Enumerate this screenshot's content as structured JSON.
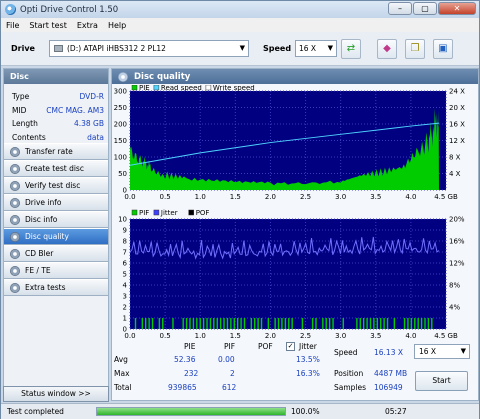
{
  "window": {
    "title": "Opti Drive Control 1.50",
    "btn_min": "–",
    "btn_max": "▢",
    "btn_close": "✕"
  },
  "menu": [
    "File",
    "Start test",
    "Extra",
    "Help"
  ],
  "toolbar": {
    "drive_label": "Drive",
    "drive_value": "(D:)    ATAPI iHBS312   2 PL12",
    "speed_label": "Speed",
    "speed_value": "16 X"
  },
  "sidebar": {
    "header": "Disc",
    "info": [
      {
        "k": "Type",
        "v": "DVD-R"
      },
      {
        "k": "MID",
        "v": "CMC MAG. AM3"
      },
      {
        "k": "Length",
        "v": "4.38 GB"
      },
      {
        "k": "Contents",
        "v": "data"
      }
    ],
    "nav": [
      "Transfer rate",
      "Create test disc",
      "Verify test disc",
      "Drive info",
      "Disc info",
      "Disc quality",
      "CD Bler",
      "FE / TE",
      "Extra tests"
    ],
    "active_index": 5,
    "status_button": "Status window >>"
  },
  "main": {
    "header": "Disc quality"
  },
  "chart_data": [
    {
      "type": "area",
      "legend": [
        "PIE",
        "Read speed",
        "Write speed"
      ],
      "legend_colors": {
        "PIE": "#00cc00",
        "Read speed": "#4fd4ff",
        "Write speed": "#ffffff"
      },
      "x_ticks": [
        "0.0",
        "0.5",
        "1.0",
        "1.5",
        "2.0",
        "2.5",
        "3.0",
        "3.5",
        "4.0",
        "4.5 GB"
      ],
      "y_left_ticks": [
        "0",
        "50",
        "100",
        "150",
        "200",
        "250",
        "300"
      ],
      "y_right_ticks": [
        "4 X",
        "8 X",
        "12 X",
        "16 X",
        "20 X",
        "24 X"
      ],
      "ylim": [
        0,
        300
      ],
      "pie_profile": {
        "x": [
          0,
          0.1,
          0.2,
          0.3,
          0.5,
          0.8,
          1.2,
          1.6,
          2.0,
          2.5,
          3.0,
          3.3,
          3.6,
          3.9,
          4.1,
          4.25,
          4.35,
          4.4
        ],
        "y": [
          120,
          95,
          85,
          70,
          45,
          38,
          30,
          22,
          20,
          20,
          25,
          45,
          55,
          70,
          110,
          150,
          200,
          230
        ]
      },
      "read_speed": {
        "x": [
          0.0,
          1.0,
          2.0,
          3.0,
          4.0,
          4.4
        ],
        "y_x": [
          6.0,
          9.0,
          11.5,
          13.5,
          15.5,
          16.2
        ]
      }
    },
    {
      "type": "bar",
      "legend": [
        "PIF",
        "Jitter",
        "POF"
      ],
      "legend_colors": {
        "PIF": "#00cc00",
        "Jitter": "#4040ff",
        "POF": "#000000"
      },
      "x_ticks": [
        "0.0",
        "0.5",
        "1.0",
        "1.5",
        "2.0",
        "2.5",
        "3.0",
        "3.5",
        "4.0",
        "4.5 GB"
      ],
      "y_left_ticks": [
        "0",
        "1",
        "2",
        "3",
        "4",
        "5",
        "6",
        "7",
        "8",
        "9",
        "10"
      ],
      "y_right_ticks": [
        "4%",
        "8%",
        "12%",
        "16%",
        "20%"
      ],
      "ylim": [
        0,
        10
      ],
      "jitter_percent_approx": 13.5
    }
  ],
  "stats": {
    "headers": [
      "PIE",
      "PIF",
      "POF",
      "Jitter"
    ],
    "rows": [
      {
        "label": "Avg",
        "pie": "52.36",
        "pif": "0.00",
        "jitter": "13.5%"
      },
      {
        "label": "Max",
        "pie": "232",
        "pif": "2",
        "jitter": "16.3%"
      },
      {
        "label": "Total",
        "pie": "939865",
        "pif": "612"
      }
    ],
    "speed_label": "Speed",
    "speed_value": "16.13 X",
    "speed_select": "16 X",
    "position_label": "Position",
    "position_value": "4487 MB",
    "samples_label": "Samples",
    "samples_value": "106949",
    "start_button": "Start"
  },
  "statusbar": {
    "status": "Test completed",
    "progress_percent": 100,
    "progress_label": "100.0%",
    "time": "05:27"
  }
}
